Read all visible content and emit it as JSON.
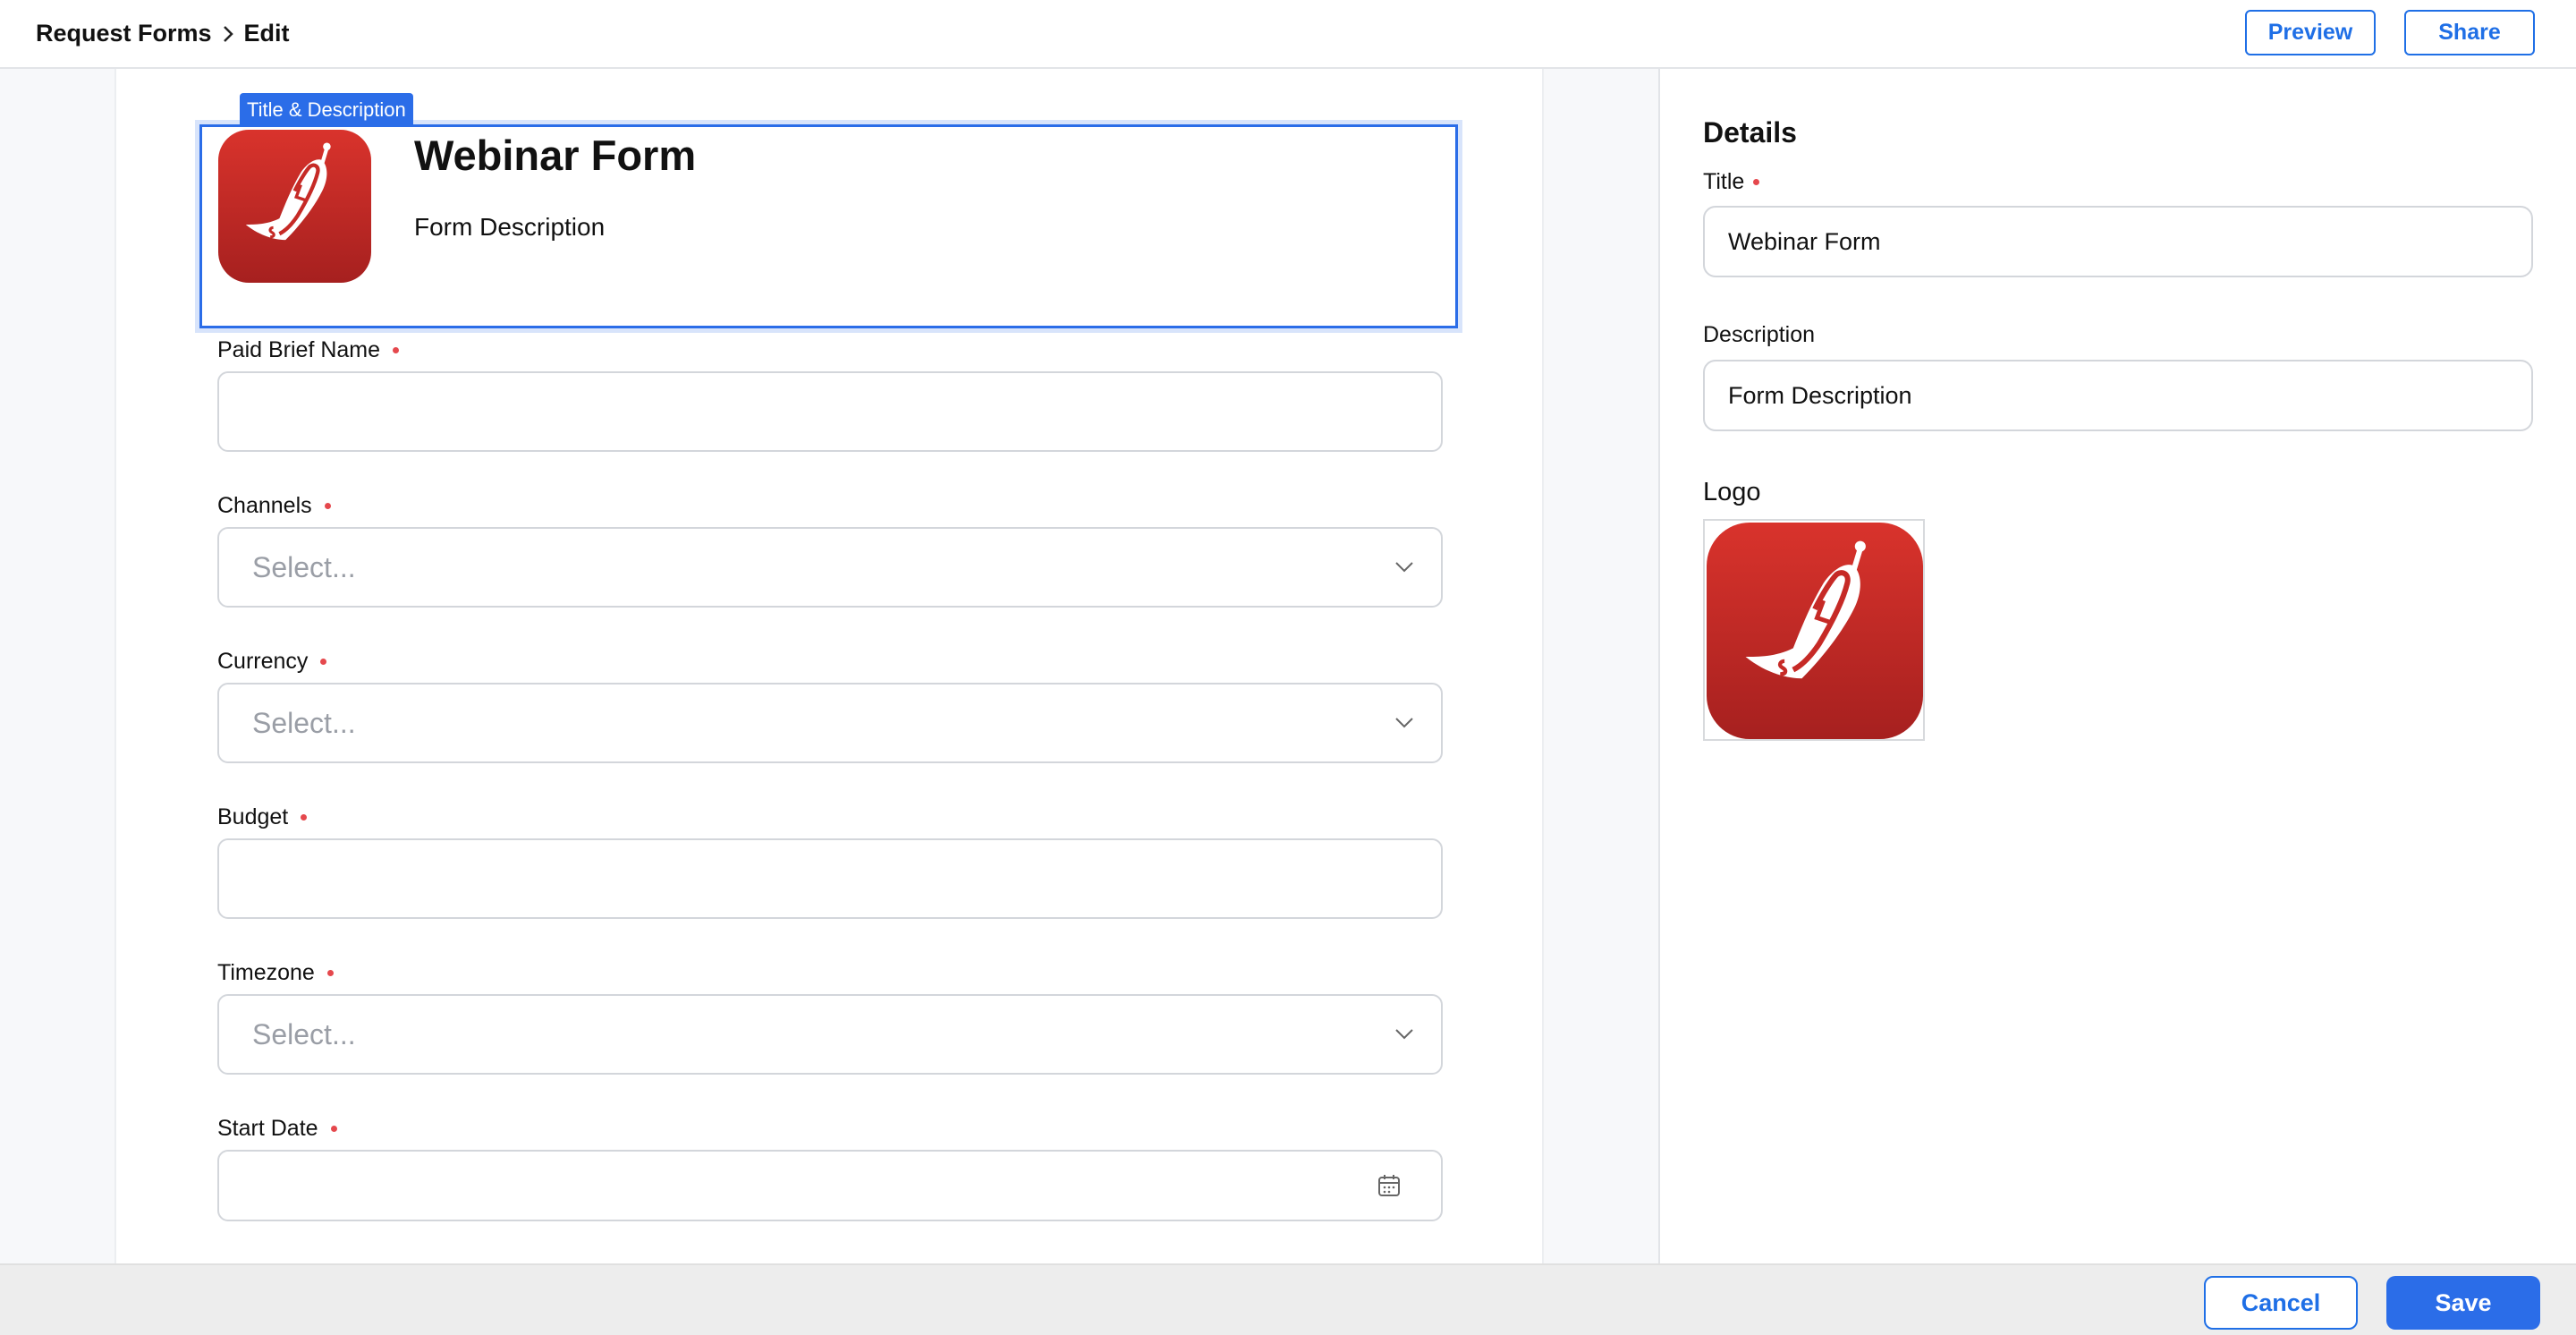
{
  "header": {
    "breadcrumb_root": "Request Forms",
    "breadcrumb_current": "Edit",
    "preview_label": "Preview",
    "share_label": "Share"
  },
  "form": {
    "section_tag": "Title & Description",
    "title": "Webinar Form",
    "description": "Form Description",
    "fields": [
      {
        "label": "Paid Brief Name",
        "type": "text",
        "placeholder": "",
        "required": true
      },
      {
        "label": "Channels",
        "type": "select",
        "placeholder": "Select...",
        "required": true
      },
      {
        "label": "Currency",
        "type": "select",
        "placeholder": "Select...",
        "required": true
      },
      {
        "label": "Budget",
        "type": "text",
        "placeholder": "",
        "required": true
      },
      {
        "label": "Timezone",
        "type": "select",
        "placeholder": "Select...",
        "required": true
      },
      {
        "label": "Start Date",
        "type": "date",
        "placeholder": "",
        "required": true
      }
    ]
  },
  "details_panel": {
    "heading": "Details",
    "title_label": "Title",
    "title_value": "Webinar Form",
    "description_label": "Description",
    "description_value": "Form Description",
    "logo_label": "Logo"
  },
  "footer": {
    "cancel_label": "Cancel",
    "save_label": "Save"
  },
  "colors": {
    "accent": "#2b6de8",
    "required": "#e5484d",
    "logo_red": "#c62a26"
  },
  "icons": {
    "breadcrumb_separator": "chevron-right-icon",
    "select_indicator": "chevron-down-icon",
    "date_indicator": "calendar-icon",
    "logo": "chili-pepper-logo"
  }
}
